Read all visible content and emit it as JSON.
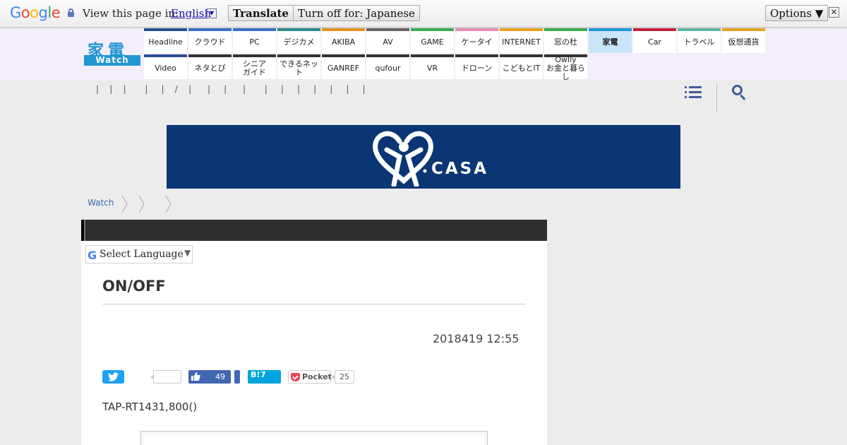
{
  "translate_bar": {
    "logo_letters": [
      {
        "ch": "G",
        "color": "#4285f4"
      },
      {
        "ch": "o",
        "color": "#ea4335"
      },
      {
        "ch": "o",
        "color": "#fbbc05"
      },
      {
        "ch": "g",
        "color": "#4285f4"
      },
      {
        "ch": "l",
        "color": "#34a853"
      },
      {
        "ch": "e",
        "color": "#ea4335"
      }
    ],
    "view_text": "View this page in:",
    "language": "English",
    "dropdown_glyph": "▼",
    "translate_label": "Translate",
    "turn_off_label": "Turn off for: Japanese",
    "options_label": "Options ▼",
    "close_glyph": "✕"
  },
  "header": {
    "logo_kanji": "家電",
    "logo_watch": "Watch",
    "nav_row1": [
      {
        "label": "Headline",
        "color": "#2b4d8f"
      },
      {
        "label": "クラウド",
        "color": "#3b6ec8"
      },
      {
        "label": "PC",
        "color": "#3b6ec8"
      },
      {
        "label": "デジカメ",
        "color": "#2a8a8a"
      },
      {
        "label": "AKIBA",
        "color": "#e4901e"
      },
      {
        "label": "AV",
        "color": "#666666"
      },
      {
        "label": "GAME",
        "color": "#3bab4f"
      },
      {
        "label": "ケータイ",
        "color": "#e88ab4"
      },
      {
        "label": "INTERNET",
        "color": "#e9a21e"
      },
      {
        "label": "窓の杜",
        "color": "#3bab4f"
      },
      {
        "label": "家電",
        "color": "#2196d3",
        "active": true
      },
      {
        "label": "Car",
        "color": "#c0223a"
      },
      {
        "label": "トラベル",
        "color": "#5cb6a8"
      },
      {
        "label": "仮想通貨",
        "color": "#e4a21e"
      }
    ],
    "nav_row2": [
      {
        "label": "Video",
        "color": "#2b4d8f"
      },
      {
        "label": "ネタとぴ",
        "color": "#333333"
      },
      {
        "label": "シニア\nガイド",
        "color": "#333333"
      },
      {
        "label": "できるネット",
        "color": "#333333"
      },
      {
        "label": "GANREF",
        "color": "#333333"
      },
      {
        "label": "qufour",
        "color": "#333333"
      },
      {
        "label": "VR",
        "color": "#333333"
      },
      {
        "label": "ドローン",
        "color": "#333333"
      },
      {
        "label": "こどもとIT",
        "color": "#333333"
      },
      {
        "label": "Owlly\nお金と暮らし",
        "color": "#333333"
      }
    ],
    "subnav_text": "|    |    |       |     |    /    |      |     |      |       |     |     |     |     |     |     |"
  },
  "ad": {
    "brand": "CASA",
    "bg_color": "#0a3673"
  },
  "breadcrumb": {
    "first": "Watch"
  },
  "article": {
    "select_language": "Select Language",
    "select_arrow": "▼",
    "title": "ON/OFF",
    "date": "2018419 12:55",
    "fb_count": "49",
    "hatena_label": "B!",
    "hatena_count": "7",
    "pocket_label": "Pocket",
    "pocket_count": "25",
    "lead": "TAP-RT1431,800()"
  }
}
